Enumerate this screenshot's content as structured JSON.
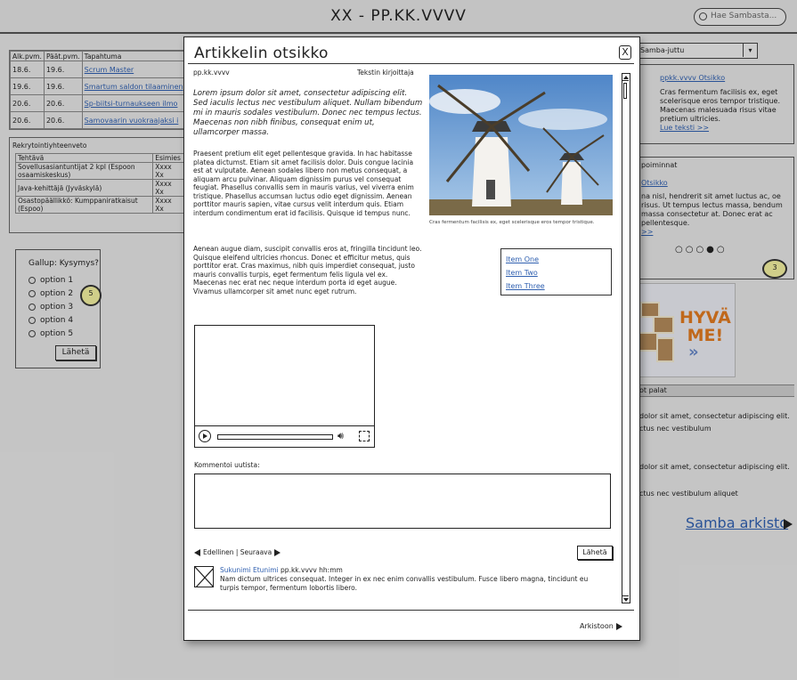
{
  "app": {
    "title": "XX - PP.KK.VVVV",
    "search_placeholder": "Hae Sambasta..."
  },
  "events": {
    "headers": [
      "Alk.pvm.",
      "Päät.pvm.",
      "Tapahtuma"
    ],
    "rows": [
      [
        "18.6.",
        "19.6.",
        "Scrum Master"
      ],
      [
        "19.6.",
        "19.6.",
        "Smartum saldon tilaaminen"
      ],
      [
        "20.6.",
        "20.6.",
        "Sp-biitsi-turnaukseen ilmo"
      ],
      [
        "20.6.",
        "20.6.",
        "Samovaarin vuokraajaksi i"
      ]
    ]
  },
  "rekry": {
    "title": "Rekrytointiyhteenveto",
    "headers": [
      "Tehtävä",
      "Esimies"
    ],
    "rows": [
      [
        "Sovellusasiantuntijat 2 kpl (Espoon osaamiskeskus)",
        "Xxxx Xx"
      ],
      [
        "Java-kehittäjä (Jyväskylä)",
        "Xxxx Xx"
      ],
      [
        "Osastopäällikkö: Kumppaniratkaisut (Espoo)",
        "Xxxx Xx"
      ]
    ]
  },
  "gallup": {
    "question": "Gallup: Kysymys?",
    "options": [
      "option 1",
      "option 2",
      "option 3",
      "option 4",
      "option 5"
    ],
    "submit": "Lähetä",
    "bubble": "5"
  },
  "right": {
    "select_value": "Samba-juttu",
    "featured": {
      "date_title": "ppkk.vvvv Otsikko",
      "text": "Cras fermentum facilisis ex, eget scelerisque eros tempor tristique. Maecenas malesuada risus vitae pretium ultricies.",
      "more": "Lue teksti >>"
    },
    "nostot": {
      "title": "poiminnat",
      "link": "Otsikko",
      "text": "na nisl, hendrerit sit amet luctus ac, oe risus. Ut tempus lectus massa, bendum massa consectetur at. Donec erat ac pellentesque.",
      "more": ">>",
      "bubble": "3"
    },
    "ad": {
      "line1": "HYVÄ",
      "line2": "ME!",
      "chevrons": "»"
    },
    "latest": {
      "title": "ot palat",
      "lines": [
        "dolor sit amet, consectetur adipiscing elit.",
        "ctus nec vestibulum",
        "dolor sit amet, consectetur adipiscing elit.",
        "ctus nec vestibulum aliquet"
      ]
    },
    "archive": "Samba arkisto"
  },
  "modal": {
    "title": "Artikkelin otsikko",
    "close": "X",
    "date": "pp.kk.vvvv",
    "author": "Tekstin kirjoittaja",
    "lead": "Lorem ipsum dolor sit amet, consectetur adipiscing elit. Sed iaculis lectus nec vestibulum aliquet. Nullam bibendum mi in mauris sodales vestibulum. Donec nec tempus lectus. Maecenas non nibh finibus, consequat enim ut, ullamcorper massa.",
    "body1": "Praesent pretium elit eget pellentesque gravida. In hac habitasse platea dictumst. Etiam sit amet facilisis dolor. Duis congue lacinia est at vulputate. Aenean sodales libero non metus consequat, a aliquam arcu pulvinar. Aliquam dignissim purus vel consequat feugiat. Phasellus convallis sem in mauris varius, vel viverra enim tristique. Phasellus accumsan luctus odio eget dignissim. Aenean porttitor mauris sapien, vitae cursus velit interdum quis. Etiam interdum condimentum erat id facilisis. Quisque id tempus nunc.",
    "body2": "Aenean augue diam, suscipit convallis eros at, fringilla tincidunt leo. Quisque eleifend ultricies rhoncus. Donec et efficitur metus, quis porttitor erat. Cras maximus, nibh quis imperdiet consequat, justo mauris convallis turpis, eget fermentum felis ligula vel ex. Maecenas nec erat nec neque interdum porta id eget augue. Vivamus ullamcorper sit amet nunc eget rutrum.",
    "caption": "Cras fermentum facilisis ex, eget scelerisque eros tempor tristique.",
    "items": [
      "Item One",
      "Item Two",
      "Item Three"
    ],
    "comment_label": "Kommentoi uutista:",
    "pager": "Edellinen | Seuraava",
    "submit": "Lähetä",
    "comment": {
      "name": "Sukunimi Etunimi",
      "time": "pp.kk.vvvv hh:mm",
      "text": "Nam dictum ultrices consequat. Integer in ex nec enim convallis vestibulum. Fusce libero magna, tincidunt eu turpis tempor, fermentum lobortis libero."
    },
    "archive": "Arkistoon"
  }
}
